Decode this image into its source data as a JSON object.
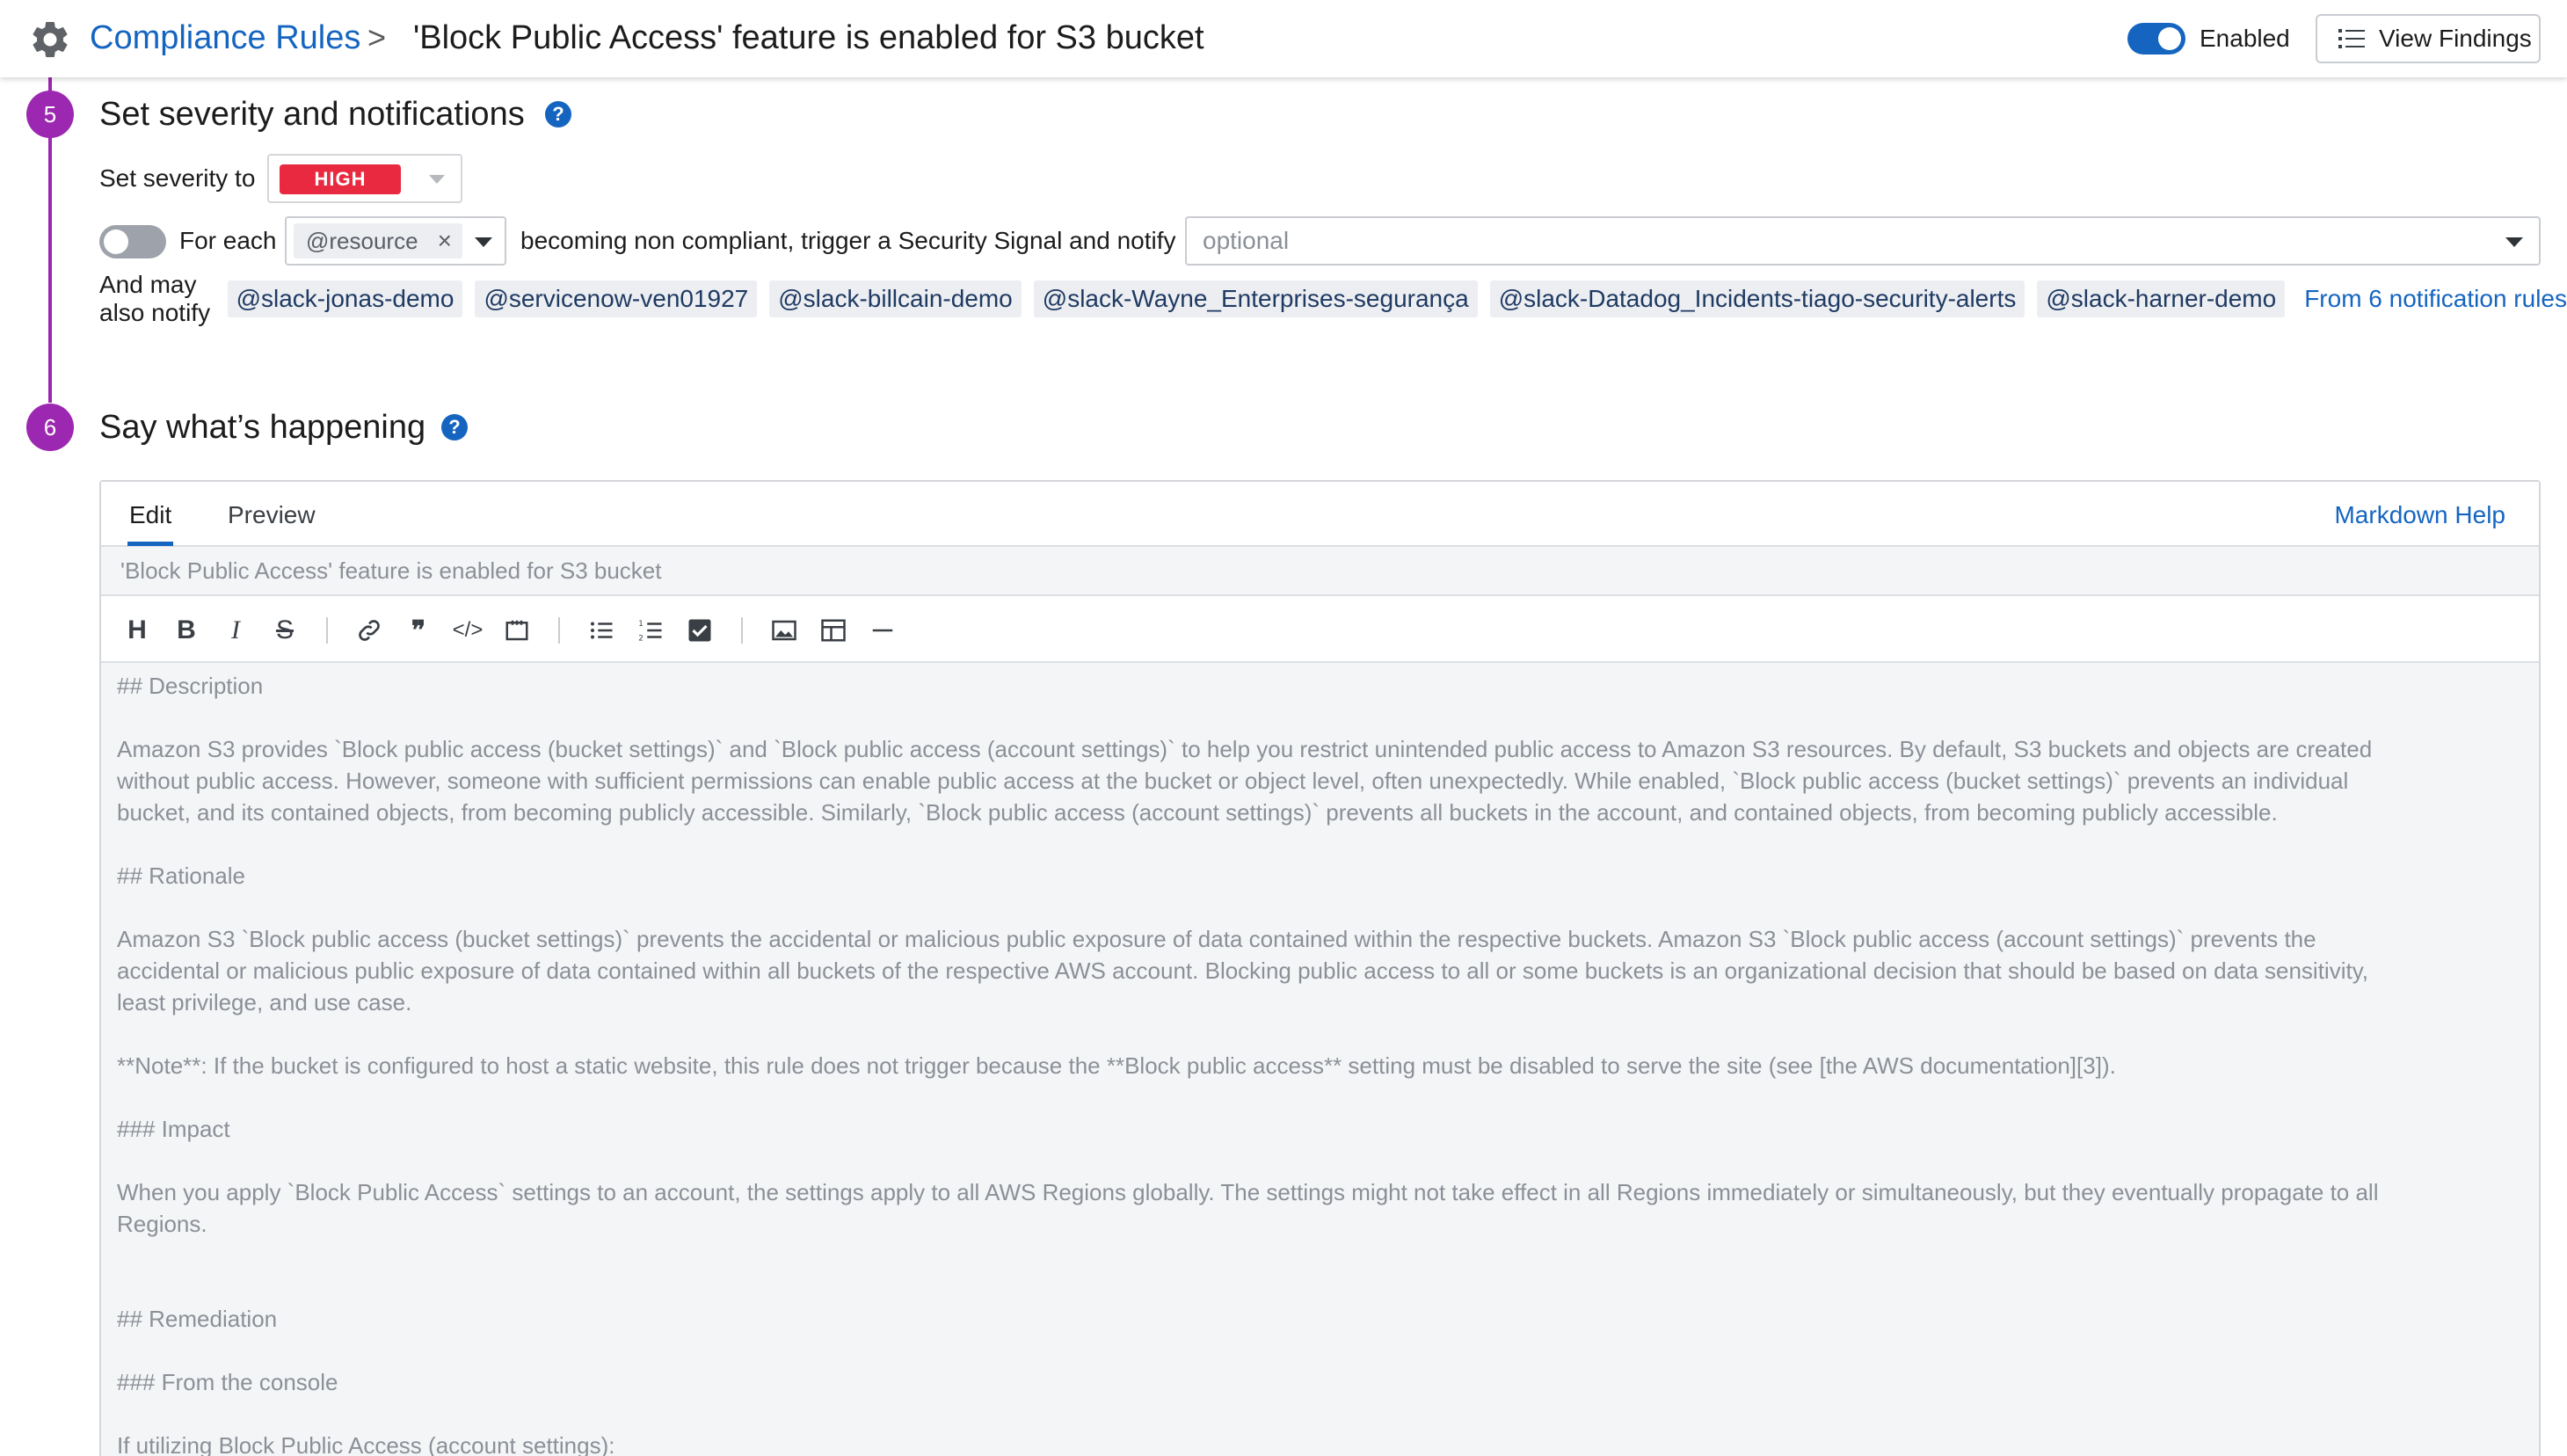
{
  "header": {
    "breadcrumb_link": "Compliance Rules",
    "breadcrumb_sep": ">",
    "title": "'Block Public Access' feature is enabled for S3 bucket",
    "toggle_label": "Enabled",
    "toggle_on": true,
    "view_findings_label": "View Findings"
  },
  "step5": {
    "number": "5",
    "title": "Set severity and notifications",
    "severity_label": "Set severity to",
    "severity_value": "HIGH",
    "severity_color": "#e8293f",
    "for_each_label": "For each",
    "for_each_toggle_on": false,
    "resource_tag": "@resource",
    "trigger_text": "becoming non compliant, trigger a Security Signal and notify",
    "notify_placeholder": "optional",
    "also_notify_label": "And may also notify",
    "mentions": [
      "@slack-jonas-demo",
      "@servicenow-ven01927",
      "@slack-billcain-demo",
      "@slack-Wayne_Enterprises-segurança",
      "@slack-Datadog_Incidents-tiago-security-alerts",
      "@slack-harner-demo"
    ],
    "from_rules": "From 6 notification rules"
  },
  "step6": {
    "number": "6",
    "title": "Say what’s happening",
    "tabs": {
      "edit": "Edit",
      "preview": "Preview"
    },
    "markdown_help": "Markdown Help",
    "title_placeholder": "'Block Public Access' feature is enabled for S3 bucket",
    "body": {
      "l1": "## Description",
      "l2": "Amazon S3 provides `Block public access (bucket settings)` and `Block public access (account settings)` to help you restrict unintended public access to Amazon S3 resources. By default, S3 buckets and objects are created",
      "l3": "without public access. However, someone with sufficient permissions can enable public access at the bucket or object level, often unexpectedly. While enabled, `Block public access (bucket settings)` prevents an individual",
      "l4": "bucket, and its contained objects, from becoming publicly accessible. Similarly, `Block public access (account settings)` prevents all buckets in the account, and contained objects, from becoming publicly accessible.",
      "l5": "## Rationale",
      "l6": "Amazon S3 `Block public access (bucket settings)` prevents the accidental or malicious public exposure of data contained within the respective buckets. Amazon S3 `Block public access (account settings)` prevents the",
      "l7": "accidental or malicious public exposure of data contained within all buckets of the respective AWS account. Blocking public access to all or some buckets is an organizational decision that should be based on data sensitivity,",
      "l8": "least privilege, and use case.",
      "l9": "**Note**: If the bucket is configured to host a static website, this rule does not trigger because the **Block public access** setting must be disabled to serve the site (see [the AWS documentation][3]).",
      "l10": "### Impact",
      "l11": "When you apply `Block Public Access` settings to an account, the settings apply to all AWS Regions globally. The settings might not take effect in all Regions immediately or simultaneously, but they eventually propagate to all",
      "l12": "Regions.",
      "l13": "## Remediation",
      "l14": "### From the console",
      "l15": "If utilizing Block Public Access (account settings):"
    }
  },
  "colors": {
    "accent": "#1565c0",
    "step": "#9c27b0"
  }
}
